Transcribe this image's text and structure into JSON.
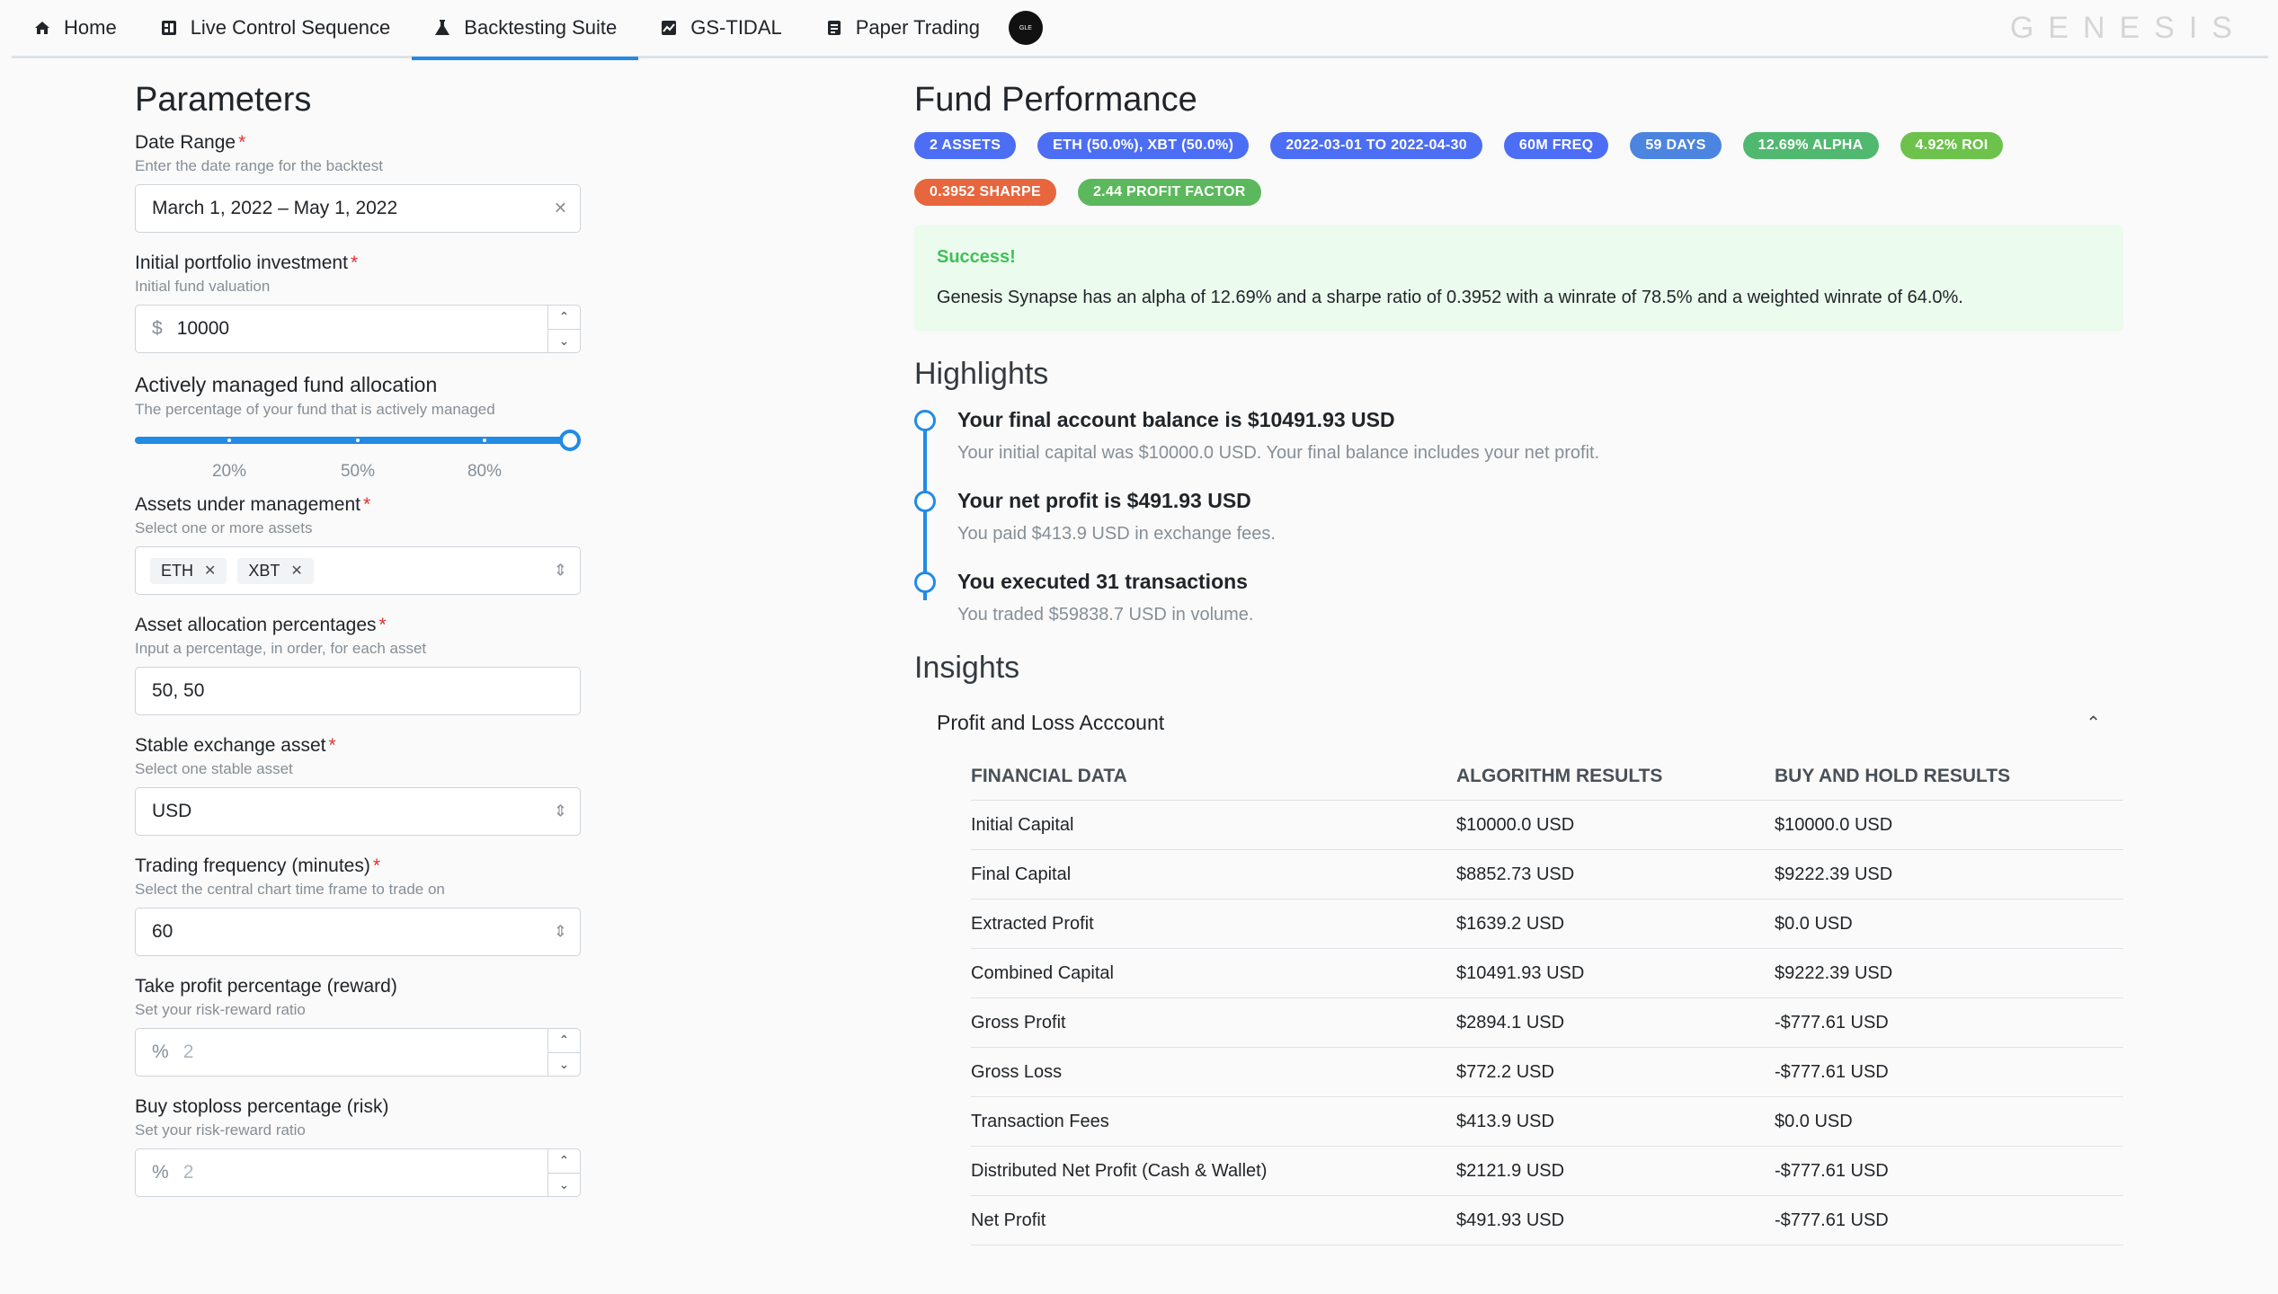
{
  "nav": {
    "tabs": [
      {
        "label": "Home",
        "icon": "home-icon"
      },
      {
        "label": "Live Control Sequence",
        "icon": "dashboard-icon"
      },
      {
        "label": "Backtesting Suite",
        "icon": "flask-icon"
      },
      {
        "label": "GS-TIDAL",
        "icon": "chart-icon"
      },
      {
        "label": "Paper Trading",
        "icon": "document-icon"
      }
    ],
    "active_tab": "Backtesting Suite",
    "avatar_text": "GLE",
    "brand": "GENESIS"
  },
  "params": {
    "title": "Parameters",
    "date_range": {
      "label": "Date Range",
      "desc": "Enter the date range for the backtest",
      "value": "March 1, 2022 – May 1, 2022"
    },
    "investment": {
      "label": "Initial portfolio investment",
      "desc": "Initial fund valuation",
      "prefix": "$",
      "value": "10000"
    },
    "allocation": {
      "label": "Actively managed fund allocation",
      "desc": "The percentage of your fund that is actively managed",
      "value_percent": 100,
      "marks": [
        "20%",
        "50%",
        "80%"
      ]
    },
    "assets": {
      "label": "Assets under management",
      "desc": "Select one or more assets",
      "values": [
        "ETH",
        "XBT"
      ]
    },
    "asset_pct": {
      "label": "Asset allocation percentages",
      "desc": "Input a percentage, in order, for each asset",
      "value": "50, 50"
    },
    "stable": {
      "label": "Stable exchange asset",
      "desc": "Select one stable asset",
      "value": "USD"
    },
    "freq": {
      "label": "Trading frequency (minutes)",
      "desc": "Select the central chart time frame to trade on",
      "value": "60"
    },
    "take_profit": {
      "label": "Take profit percentage (reward)",
      "desc": "Set your risk-reward ratio",
      "prefix": "%",
      "value": "2"
    },
    "stoploss": {
      "label": "Buy stoploss percentage (risk)",
      "desc": "Set your risk-reward ratio",
      "prefix": "%",
      "value": "2"
    }
  },
  "performance": {
    "title": "Fund Performance",
    "badges": [
      {
        "text": "2 Assets",
        "color": "#4c6ef5"
      },
      {
        "text": "ETH (50.0%), XBT (50.0%)",
        "color": "#4c6ef5"
      },
      {
        "text": "2022-03-01 to 2022-04-30",
        "color": "#4c6ef5"
      },
      {
        "text": "60m Freq",
        "color": "#4c6ef5"
      },
      {
        "text": "59 Days",
        "color": "#4c85e0"
      },
      {
        "text": "12.69% Alpha",
        "color": "#51b86f"
      },
      {
        "text": "4.92% ROI",
        "color": "#6cc24a"
      },
      {
        "text": "0.3952 Sharpe",
        "color": "#e8663d"
      },
      {
        "text": "2.44 Profit Factor",
        "color": "#5cb85c"
      }
    ],
    "alert": {
      "title": "Success!",
      "text": "Genesis Synapse has an alpha of 12.69% and a sharpe ratio of 0.3952 with a winrate of 78.5% and a weighted winrate of 64.0%."
    }
  },
  "highlights": {
    "title": "Highlights",
    "items": [
      {
        "title": "Your final account balance is $10491.93 USD",
        "sub": "Your initial capital was $10000.0 USD. Your final balance includes your net profit."
      },
      {
        "title": "Your net profit is $491.93 USD",
        "sub": "You paid $413.9 USD in exchange fees."
      },
      {
        "title": "You executed 31 transactions",
        "sub": "You traded $59838.7 USD in volume."
      }
    ]
  },
  "insights": {
    "title": "Insights",
    "accordion_label": "Profit and Loss Acccount",
    "table": {
      "headers": [
        "Financial Data",
        "Algorithm Results",
        "Buy and Hold Results"
      ],
      "rows": [
        [
          "Initial Capital",
          "$10000.0 USD",
          "$10000.0 USD"
        ],
        [
          "Final Capital",
          "$8852.73 USD",
          "$9222.39 USD"
        ],
        [
          "Extracted Profit",
          "$1639.2 USD",
          "$0.0 USD"
        ],
        [
          "Combined Capital",
          "$10491.93 USD",
          "$9222.39 USD"
        ],
        [
          "Gross Profit",
          "$2894.1 USD",
          "-$777.61 USD"
        ],
        [
          "Gross Loss",
          "$772.2 USD",
          "-$777.61 USD"
        ],
        [
          "Transaction Fees",
          "$413.9 USD",
          "$0.0 USD"
        ],
        [
          "Distributed Net Profit (Cash & Wallet)",
          "$2121.9 USD",
          "-$777.61 USD"
        ],
        [
          "Net Profit",
          "$491.93 USD",
          "-$777.61 USD"
        ]
      ]
    }
  }
}
